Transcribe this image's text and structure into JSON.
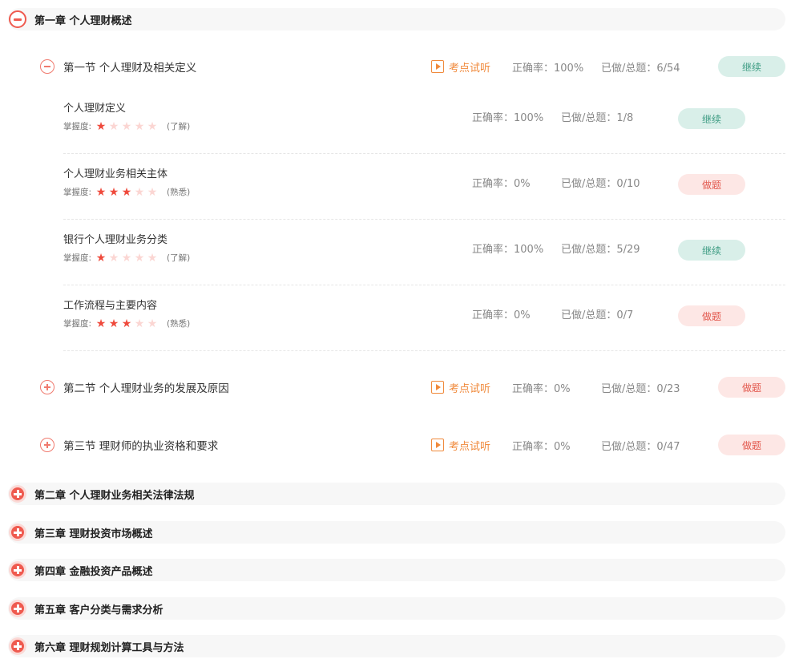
{
  "chapters": [
    {
      "title": "第一章  个人理财概述",
      "expanded": true
    },
    {
      "title": "第二章  个人理财业务相关法律法规",
      "expanded": false
    },
    {
      "title": "第三章  理财投资市场概述",
      "expanded": false
    },
    {
      "title": "第四章  金融投资产品概述",
      "expanded": false
    },
    {
      "title": "第五章  客户分类与需求分析",
      "expanded": false
    },
    {
      "title": "第六章  理财规划计算工具与方法",
      "expanded": false
    }
  ],
  "sections": [
    {
      "title": "第一节  个人理财及相关定义",
      "trial": "考点试听",
      "accuracy": "正确率：100%",
      "progress": "已做/总题：6/54",
      "button": "继续",
      "expanded": true
    },
    {
      "title": "第二节  个人理财业务的发展及原因",
      "trial": "考点试听",
      "accuracy": "正确率：0%",
      "progress": "已做/总题：0/23",
      "button": "做题",
      "expanded": false
    },
    {
      "title": "第三节  理财师的执业资格和要求",
      "trial": "考点试听",
      "accuracy": "正确率：0%",
      "progress": "已做/总题：0/47",
      "button": "做题",
      "expanded": false
    }
  ],
  "points": [
    {
      "title": "个人理财定义",
      "mastery_label": "掌握度:",
      "stars": 1,
      "level": "(了解)",
      "accuracy": "正确率：100%",
      "progress": "已做/总题：1/8",
      "button": "继续"
    },
    {
      "title": "个人理财业务相关主体",
      "mastery_label": "掌握度:",
      "stars": 3,
      "level": "(熟悉)",
      "accuracy": "正确率：0%",
      "progress": "已做/总题：0/10",
      "button": "做题"
    },
    {
      "title": "银行个人理财业务分类",
      "mastery_label": "掌握度:",
      "stars": 1,
      "level": "(了解)",
      "accuracy": "正确率：100%",
      "progress": "已做/总题：5/29",
      "button": "继续"
    },
    {
      "title": "工作流程与主要内容",
      "mastery_label": "掌握度:",
      "stars": 3,
      "level": "(熟悉)",
      "accuracy": "正确率：0%",
      "progress": "已做/总题：0/7",
      "button": "做题"
    }
  ],
  "max_stars": 5,
  "colors": {
    "star_on": "#ef4a3c",
    "star_off": "#fbd6d3",
    "continue_bg": "#d9efe9",
    "do_bg": "#fde7e5",
    "trial": "#f08a3c"
  }
}
